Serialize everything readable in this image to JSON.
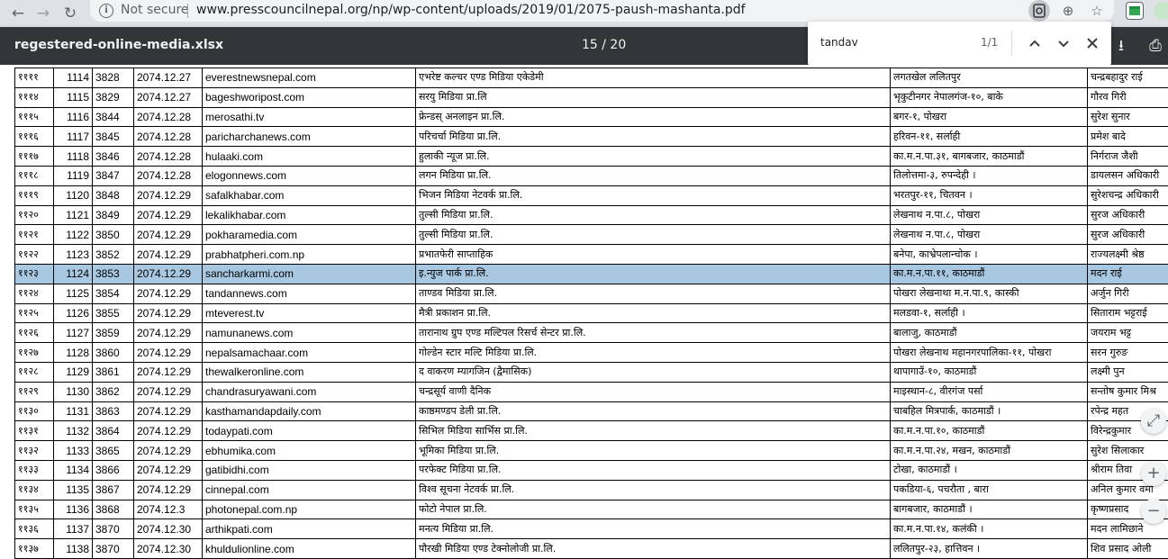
{
  "browser": {
    "security_label": "Not secure",
    "url": "www.presscouncilnepal.org/np/wp-content/uploads/2019/01/2075-paush-mashanta.pdf",
    "back_icon": "←",
    "forward_icon": "→",
    "reload_icon": "↻",
    "info_icon": "i",
    "zoom_icon": "⊕",
    "bookmark_icon": "☆"
  },
  "pdf": {
    "title": "regestered-online-media.xlsx",
    "page_indicator": "15 / 20",
    "download_icon": "⭳",
    "print_icon": "⎙"
  },
  "find": {
    "query": "tandav",
    "count": "1/1",
    "prev_icon": "⌃",
    "next_icon": "⌄",
    "close_icon": "✕"
  },
  "table": {
    "highlight_row_index": 10,
    "rows": [
      {
        "sn": "११११",
        "id": "1114",
        "reg": "3828",
        "date": "2074.12.27",
        "site": "everestnewsnepal.com",
        "org": "एभरेष्ट कल्चर एण्ड मिडिया एकेडेमी",
        "addr": "लगतखेल ललितपुर",
        "person": "चन्द्रबहादुर राई"
      },
      {
        "sn": "१११४",
        "id": "1115",
        "reg": "3829",
        "date": "2074.12.27",
        "site": "bageshworipost.com",
        "org": "सरयु मिडिया प्रा.लि",
        "addr": "भृकुटीनगर नेपालगंज-१०, बाके",
        "person": "गौरव गिरी"
      },
      {
        "sn": "१११५",
        "id": "1116",
        "reg": "3844",
        "date": "2074.12.28",
        "site": "merosathi.tv",
        "org": "फ्रेन्डस् अनलाइन प्रा.लि.",
        "addr": "बगर-१, पोखरा",
        "person": "सुरेश सुनार"
      },
      {
        "sn": "१११६",
        "id": "1117",
        "reg": "3845",
        "date": "2074.12.28",
        "site": "paricharchanews.com",
        "org": "परिचर्चा मिडिया प्रा.लि.",
        "addr": "हरिवन-११, सर्लाही",
        "person": "प्रमेश बादे"
      },
      {
        "sn": "१११७",
        "id": "1118",
        "reg": "3846",
        "date": "2074.12.28",
        "site": "hulaaki.com",
        "org": "हुलाकी न्यूज प्रा.लि.",
        "addr": "का.म.न.पा.३१, बागबजार, काठमाडौं",
        "person": "निर्गराज जैशी"
      },
      {
        "sn": "१११८",
        "id": "1119",
        "reg": "3847",
        "date": "2074.12.28",
        "site": "elogonnews.com",
        "org": "लगन मिडिया प्रा.लि.",
        "addr": "तिलोत्तमा-३, रुपन्देही ।",
        "person": "डायलसन अधिकारी"
      },
      {
        "sn": "१११९",
        "id": "1120",
        "reg": "3848",
        "date": "2074.12.29",
        "site": "safalkhabar.com",
        "org": "भिजन मिडिया नेटवर्क प्रा.लि.",
        "addr": "भरतपुर-११, चितवन ।",
        "person": "सुरेशचन्द्र अधिकारी"
      },
      {
        "sn": "११२०",
        "id": "1121",
        "reg": "3849",
        "date": "2074.12.29",
        "site": "lekalikhabar.com",
        "org": "तुल्सी मिडिया प्रा.लि.",
        "addr": "लेखनाथ न.पा.८, पोखरा",
        "person": "सुरज अधिकारी"
      },
      {
        "sn": "११२१",
        "id": "1122",
        "reg": "3850",
        "date": "2074.12.29",
        "site": "pokharamedia.com",
        "org": "तुल्सी मिडिया प्रा.लि.",
        "addr": "लेखनाथ न.पा.८, पोखरा",
        "person": "सुरज अधिकारी"
      },
      {
        "sn": "११२२",
        "id": "1123",
        "reg": "3852",
        "date": "2074.12.29",
        "site": "prabhatpheri.com.np",
        "org": "प्रभातफेरी साप्ताहिक",
        "addr": "बनेपा, काभ्रेपलान्चोक ।",
        "person": "राज्यलक्ष्मी श्रेष्ठ"
      },
      {
        "sn": "११२३",
        "id": "1124",
        "reg": "3853",
        "date": "2074.12.29",
        "site": "sancharkarmi.com",
        "org": "इ.न्युज पार्क प्रा.लि.",
        "addr": "का.म.न.पा.११, काठमाडौं",
        "person": "मदन राई"
      },
      {
        "sn": "११२४",
        "id": "1125",
        "reg": "3854",
        "date": "2074.12.29",
        "site": "tandannews.com",
        "org": "ताण्डव मिडिया प्रा.लि.",
        "addr": "पोखरा लेखनाथा म.न.पा.९, कास्की",
        "person": "अर्जुन गिरी"
      },
      {
        "sn": "११२५",
        "id": "1126",
        "reg": "3855",
        "date": "2074.12.29",
        "site": "mteverest.tv",
        "org": "मैत्री प्रकाशन प्रा.लि.",
        "addr": "मलडवा-१, सर्लाही ।",
        "person": "सिताराम भट्टराई"
      },
      {
        "sn": "११२६",
        "id": "1127",
        "reg": "3859",
        "date": "2074.12.29",
        "site": "namunanews.com",
        "org": "तारानाथ ग्रुप एण्ड मल्टिपल रिसर्च सेन्टर प्रा.लि.",
        "addr": "बालाजु, काठमाडौं",
        "person": "जयराम भट्ट"
      },
      {
        "sn": "११२७",
        "id": "1128",
        "reg": "3860",
        "date": "2074.12.29",
        "site": "nepalsamachaar.com",
        "org": "गोल्डेन स्टार मल्टि मिडिया प्रा.लि.",
        "addr": "पोखरा लेखनाथ महानगरपालिका-११, पोखरा",
        "person": "सरन गुरुङ"
      },
      {
        "sn": "११२८",
        "id": "1129",
        "reg": "3861",
        "date": "2074.12.29",
        "site": "thewalkeronline.com",
        "org": "द वाकरण म्यागजिन (द्वैमासिक)",
        "addr": "थापागाउँ-१०, काठमाडौं",
        "person": "लक्ष्मी पुन"
      },
      {
        "sn": "११२९",
        "id": "1130",
        "reg": "3862",
        "date": "2074.12.29",
        "site": "chandrasuryawani.com",
        "org": "चन्द्रसूर्य वाणी दैनिक",
        "addr": "माइस्थान-८, वीरगंज पर्सा",
        "person": "सन्तोष कुमार मिश्र"
      },
      {
        "sn": "११३०",
        "id": "1131",
        "reg": "3863",
        "date": "2074.12.29",
        "site": "kasthamandapdaily.com",
        "org": "काष्ठमण्डप डेली प्रा.लि.",
        "addr": "चाबहिल मित्रपार्क, काठमाडौं ।",
        "person": "रपेन्द्र महत"
      },
      {
        "sn": "११३१",
        "id": "1132",
        "reg": "3864",
        "date": "2074.12.29",
        "site": "todaypati.com",
        "org": "सिभिल मिडिया सार्भिस प्रा.लि.",
        "addr": "का.म.न.पा.१०, काठमाडौं",
        "person": "विरेन्द्रकुमार"
      },
      {
        "sn": "११३२",
        "id": "1133",
        "reg": "3865",
        "date": "2074.12.29",
        "site": "ebhumika.com",
        "org": "भूमिका मिडिया प्रा.लि.",
        "addr": "का.म.न.पा.२४, मखन, काठमाडौं",
        "person": "सुरेश सिलाकार"
      },
      {
        "sn": "११३३",
        "id": "1134",
        "reg": "3866",
        "date": "2074.12.29",
        "site": "gatibidhi.com",
        "org": "परफेक्ट मिडिया प्रा.लि.",
        "addr": "टोखा, काठमाडौं ।",
        "person": "श्रीराम तिवा"
      },
      {
        "sn": "११३४",
        "id": "1135",
        "reg": "3867",
        "date": "2074.12.29",
        "site": "cinnepal.com",
        "org": "विश्व सूचना नेटवर्क प्रा.लि.",
        "addr": "पकडिया-६, पचरौता , बारा",
        "person": "अनिल कुमार वर्मा"
      },
      {
        "sn": "११३५",
        "id": "1136",
        "reg": "3868",
        "date": "2074.12.3",
        "site": "photonepal.com.np",
        "org": "फोटो नेपाल प्रा.लि.",
        "addr": "बागबजार, काठमाडौं ।",
        "person": "कृष्णप्रसाद"
      },
      {
        "sn": "११३६",
        "id": "1137",
        "reg": "3870",
        "date": "2074.12.30",
        "site": "arthikpati.com",
        "org": "मनत्य मिडिया प्रा.लि.",
        "addr": "का.म.न.पा.१४, कलंकी ।",
        "person": "मदन लामिछाने"
      },
      {
        "sn": "११३७",
        "id": "1138",
        "reg": "3870",
        "date": "2074.12.30",
        "site": "khuldulionline.com",
        "org": "पौरखी मिडिया एण्ड टेक्नोलोजी प्रा.लि.",
        "addr": "ललितपुर-२३, हात्तिवन ।",
        "person": "शिव प्रसाद ओली"
      }
    ]
  },
  "zoom": {
    "fit_icon": "⤢",
    "zoom_in_icon": "+",
    "zoom_out_icon": "−"
  }
}
